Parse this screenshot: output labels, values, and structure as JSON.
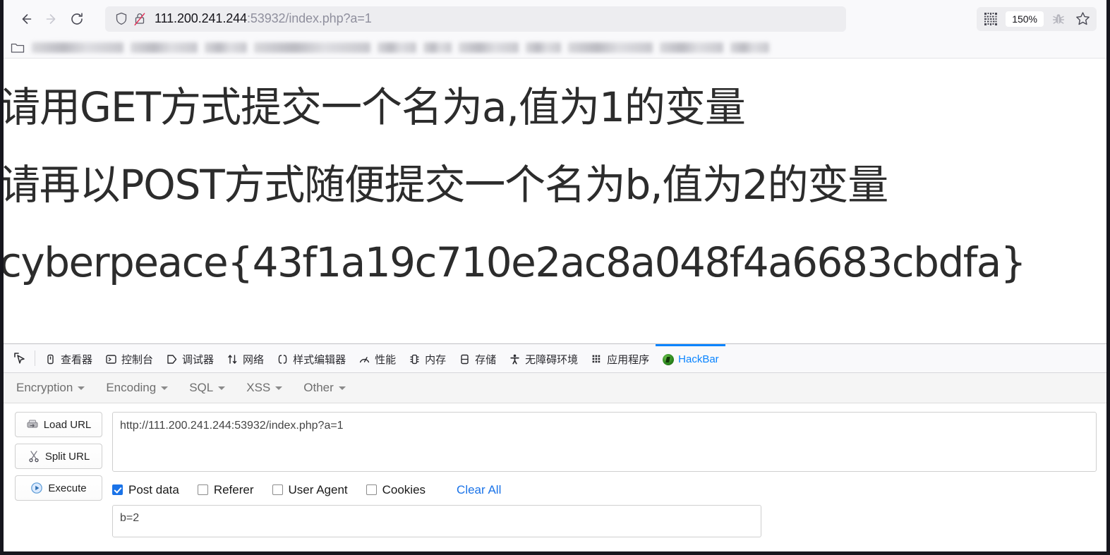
{
  "browser": {
    "nav": {
      "back_icon": "arrow-left-icon",
      "forward_icon": "arrow-right-icon",
      "reload_icon": "reload-icon"
    },
    "address_bar": {
      "shield_icon": "shield-icon",
      "insecure_icon": "lock-crossed-icon",
      "url_host": "111.200.241.244",
      "url_rest": ":53932/index.php?a=1",
      "full_url": "111.200.241.244:53932/index.php?a=1"
    },
    "toolbar_right": {
      "qr_icon": "qr-code-icon",
      "zoom_level": "150%",
      "bug_icon": "bug-icon",
      "bookmark_icon": "star-icon"
    },
    "bookmarks_bar": {
      "folder_icon": "folder-icon",
      "items_blurred": [
        130,
        95,
        60,
        165,
        55,
        40,
        85,
        50,
        120,
        90,
        55
      ]
    }
  },
  "page_content": {
    "line1": "请用GET方式提交一个名为a,值为1的变量",
    "line2": "请再以POST方式随便提交一个名为b,值为2的变量",
    "line3": "cyberpeace{43f1a19c710e2ac8a048f4a6683cbdfa}"
  },
  "devtools": {
    "picker_icon": "element-picker-icon",
    "tabs": [
      {
        "label": "查看器",
        "icon": "inspector-icon",
        "active": false
      },
      {
        "label": "控制台",
        "icon": "console-icon",
        "active": false
      },
      {
        "label": "调试器",
        "icon": "debugger-icon",
        "active": false
      },
      {
        "label": "网络",
        "icon": "network-icon",
        "active": false
      },
      {
        "label": "样式编辑器",
        "icon": "style-editor-icon",
        "active": false
      },
      {
        "label": "性能",
        "icon": "performance-icon",
        "active": false
      },
      {
        "label": "内存",
        "icon": "memory-icon",
        "active": false
      },
      {
        "label": "存储",
        "icon": "storage-icon",
        "active": false
      },
      {
        "label": "无障碍环境",
        "icon": "accessibility-icon",
        "active": false
      },
      {
        "label": "应用程序",
        "icon": "application-icon",
        "active": false
      },
      {
        "label": "HackBar",
        "icon": "hackbar-icon",
        "active": true
      }
    ]
  },
  "hackbar": {
    "menu": [
      {
        "label": "Encryption"
      },
      {
        "label": "Encoding"
      },
      {
        "label": "SQL"
      },
      {
        "label": "XSS"
      },
      {
        "label": "Other"
      }
    ],
    "buttons": [
      {
        "label": "Load URL",
        "icon": "load-url-icon"
      },
      {
        "label": "Split URL",
        "icon": "scissors-icon"
      },
      {
        "label": "Execute",
        "icon": "play-icon"
      }
    ],
    "url_value": "http://111.200.241.244:53932/index.php?a=1",
    "options": [
      {
        "label": "Post data",
        "checked": true
      },
      {
        "label": "Referer",
        "checked": false
      },
      {
        "label": "User Agent",
        "checked": false
      },
      {
        "label": "Cookies",
        "checked": false
      }
    ],
    "clear_all_label": "Clear All",
    "post_data_value": "b=2"
  },
  "colors": {
    "accent_blue": "#0a84ff",
    "link_blue": "#1a73e8",
    "chrome_bg": "#f9f9fb",
    "text_dark": "#15141a"
  }
}
